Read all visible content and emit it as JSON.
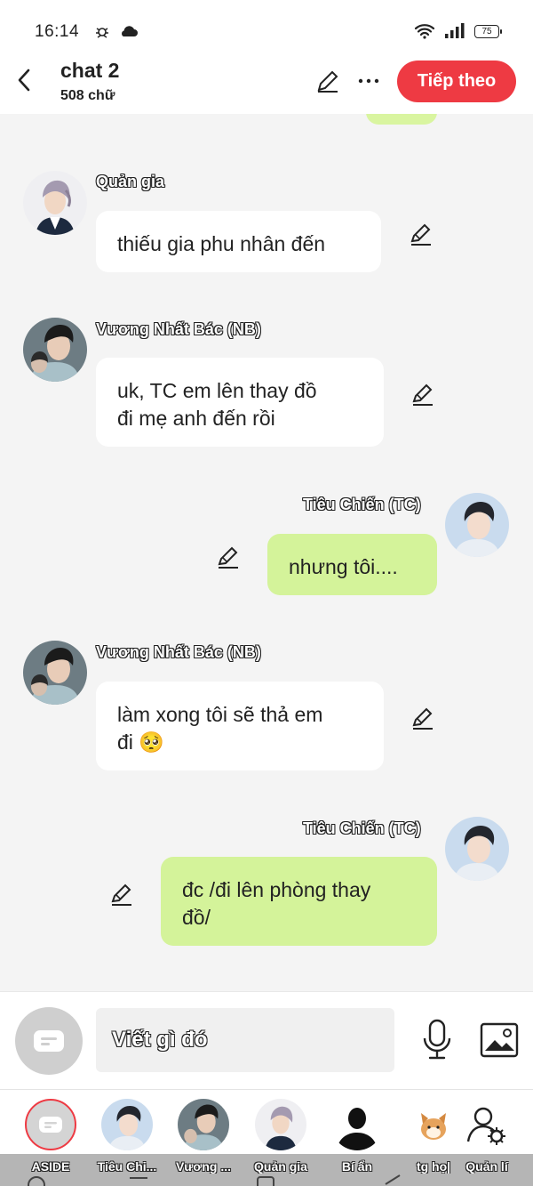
{
  "status_bar": {
    "time": "16:14",
    "battery": "75"
  },
  "header": {
    "title": "chat 2",
    "word_count": "508 chữ",
    "next_label": "Tiếp theo"
  },
  "messages": [
    {
      "sender": "Quản gia",
      "side": "left",
      "text": "thiếu gia phu nhân đến"
    },
    {
      "sender": "Vương Nhất Bác (NB)",
      "side": "left",
      "text_line1": "uk, TC em lên thay đồ",
      "text_line2": "đi mẹ anh đến rồi"
    },
    {
      "sender": "Tiêu Chiến (TC)",
      "side": "right",
      "text": "nhưng tôi...."
    },
    {
      "sender": "Vương Nhất Bác (NB)",
      "side": "left",
      "text_line1": "làm xong tôi sẽ thả em",
      "text_line2": "đi 🥺"
    },
    {
      "sender": "Tiêu Chiến (TC)",
      "side": "right",
      "text_line1": "đc /đi lên phòng thay",
      "text_line2": "đồ/"
    }
  ],
  "composer": {
    "placeholder": "Viết gì đó"
  },
  "characters": [
    {
      "label": "ASIDE"
    },
    {
      "label": "Tiêu Chi..."
    },
    {
      "label": "Vương ..."
    },
    {
      "label": "Quản gia"
    },
    {
      "label": "Bí ẩn"
    },
    {
      "label": "tg họ|"
    },
    {
      "label": "Quản lí"
    }
  ],
  "colors": {
    "accent": "#ee3a43",
    "right_bubble": "#d4f39a",
    "left_bubble": "#ffffff",
    "background": "#f4f4f4"
  }
}
